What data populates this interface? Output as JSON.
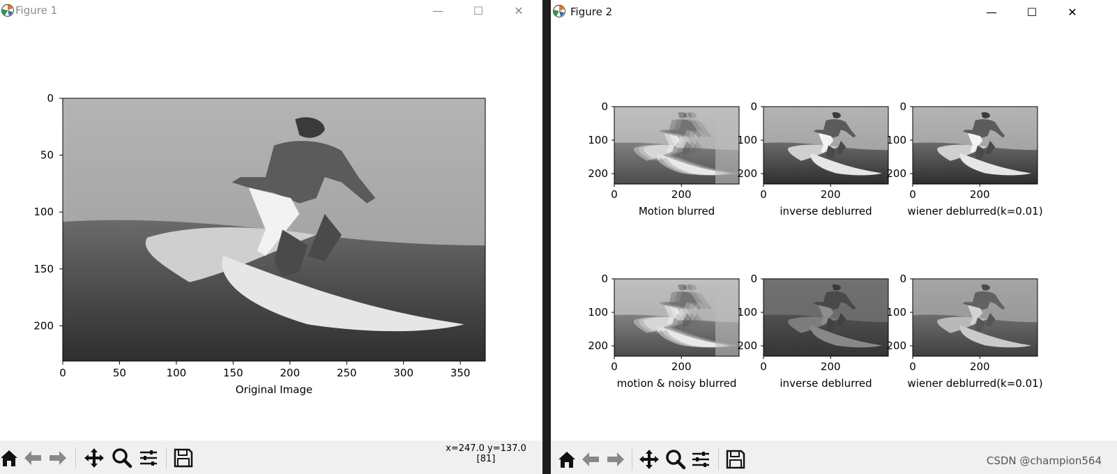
{
  "figure1": {
    "title": "Figure 1",
    "controls": {
      "minimize": "—",
      "maximize": "☐",
      "close": "✕"
    },
    "axes": {
      "xticks": [
        "0",
        "50",
        "100",
        "150",
        "200",
        "250",
        "300",
        "350"
      ],
      "yticks": [
        "0",
        "50",
        "100",
        "150",
        "200"
      ],
      "xlabel": "Original Image"
    },
    "status": {
      "line1": "x=247.0 y=137.0",
      "line2": "[81]"
    }
  },
  "figure2": {
    "title": "Figure 2",
    "controls": {
      "minimize": "—",
      "maximize": "☐",
      "close": "✕"
    },
    "subplots": [
      {
        "label": "Motion blurred",
        "xticks": [
          "0",
          "200"
        ],
        "yticks": [
          "0",
          "100",
          "200"
        ]
      },
      {
        "label": "inverse deblurred",
        "xticks": [
          "0",
          "200"
        ],
        "yticks": [
          "0",
          "100",
          "200"
        ]
      },
      {
        "label": "wiener deblurred(k=0.01)",
        "xticks": [
          "0",
          "200"
        ],
        "yticks": [
          "0",
          "100",
          "200"
        ]
      },
      {
        "label": "motion & noisy blurred",
        "xticks": [
          "0",
          "200"
        ],
        "yticks": [
          "0",
          "100",
          "200"
        ]
      },
      {
        "label": "inverse deblurred",
        "xticks": [
          "0",
          "200"
        ],
        "yticks": [
          "0",
          "100",
          "200"
        ]
      },
      {
        "label": "wiener deblurred(k=0.01)",
        "xticks": [
          "0",
          "200"
        ],
        "yticks": [
          "0",
          "100",
          "200"
        ]
      }
    ]
  },
  "toolbar_icons": [
    "home-icon",
    "back-arrow-icon",
    "forward-arrow-icon",
    "pan-icon",
    "zoom-icon",
    "configure-subplots-icon",
    "save-icon"
  ],
  "watermark": "CSDN @champion564"
}
